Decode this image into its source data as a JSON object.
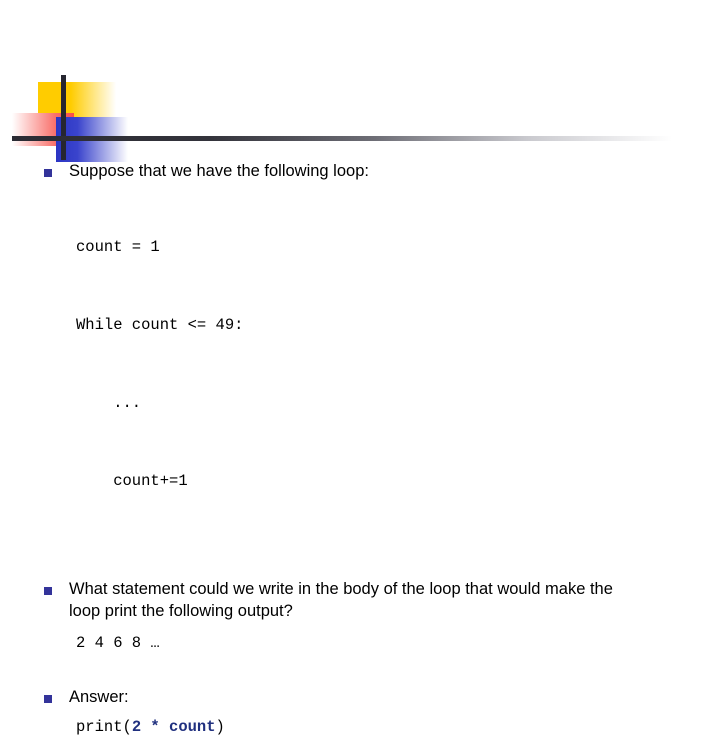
{
  "slide": {
    "decoration": {
      "yellow_color": "#ffcc00",
      "red_color": "#f94d46",
      "blue_color": "#2b35c4",
      "bar_color": "#262630"
    },
    "bullet_color": "#33339a",
    "blocks": [
      {
        "bullet": "Suppose that we have the following loop:",
        "code": [
          "count = 1",
          "While count <= 49:",
          "    ...",
          "    count+=1"
        ]
      },
      {
        "bullet": "What statement could we write in the body of the loop that would make the loop print the following output?",
        "output": "2 4 6 8 …"
      },
      {
        "bullet": "Answer:",
        "answer_code": {
          "prefix": "print(",
          "highlight": "2 * count",
          "suffix": ")",
          "highlight_color": "#20307f"
        }
      }
    ]
  }
}
